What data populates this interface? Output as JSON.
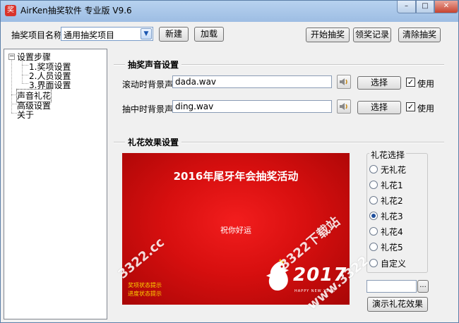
{
  "window": {
    "title": "AirKen抽奖软件 专业版 V9.6",
    "icon_glyph": "奖",
    "controls": {
      "minimize": "–",
      "maximize": "□",
      "close": "✕"
    }
  },
  "toolbar": {
    "project_label": "抽奖项目名称",
    "project_value": "通用抽奖项目",
    "new_label": "新建",
    "load_label": "加载",
    "start_label": "开始抽奖",
    "records_label": "领奖记录",
    "clear_label": "清除抽奖"
  },
  "tree": {
    "toggle": "−",
    "items": [
      {
        "label": "设置步骤"
      },
      {
        "label": "1.奖项设置"
      },
      {
        "label": "2.人员设置"
      },
      {
        "label": "3.界面设置"
      },
      {
        "label": "声音礼花",
        "selected": true
      },
      {
        "label": "高级设置"
      },
      {
        "label": "关于"
      }
    ]
  },
  "sound": {
    "section_title": "抽奖声音设置",
    "rows": [
      {
        "label": "滚动时背景声:",
        "file": "dada.wav",
        "choose": "选择",
        "use_label": "使用",
        "use_checked": true
      },
      {
        "label": "抽中时背景声:",
        "file": "ding.wav",
        "choose": "选择",
        "use_label": "使用",
        "use_checked": true
      }
    ]
  },
  "fireworks": {
    "section_title": "礼花效果设置",
    "group_title": "礼花选择",
    "options": [
      "无礼花",
      "礼花1",
      "礼花2",
      "礼花3",
      "礼花4",
      "礼花5",
      "自定义"
    ],
    "selected_index": 3,
    "custom_path": "",
    "browse_label": "...",
    "demo_label": "演示礼花效果"
  },
  "preview": {
    "title": "2016年尾牙年会抽奖活动",
    "subtitle": "祝你好运",
    "status_lines": [
      "奖项状态提示",
      "进度状态提示"
    ],
    "year": "2017",
    "caption": "HAPPY NEW YEAR"
  },
  "watermarks": [
    "3322.cc",
    "3322下载站",
    "www.3322"
  ],
  "colors": {
    "preview_red": "#d70f0f",
    "highlight": "#ffd400"
  }
}
